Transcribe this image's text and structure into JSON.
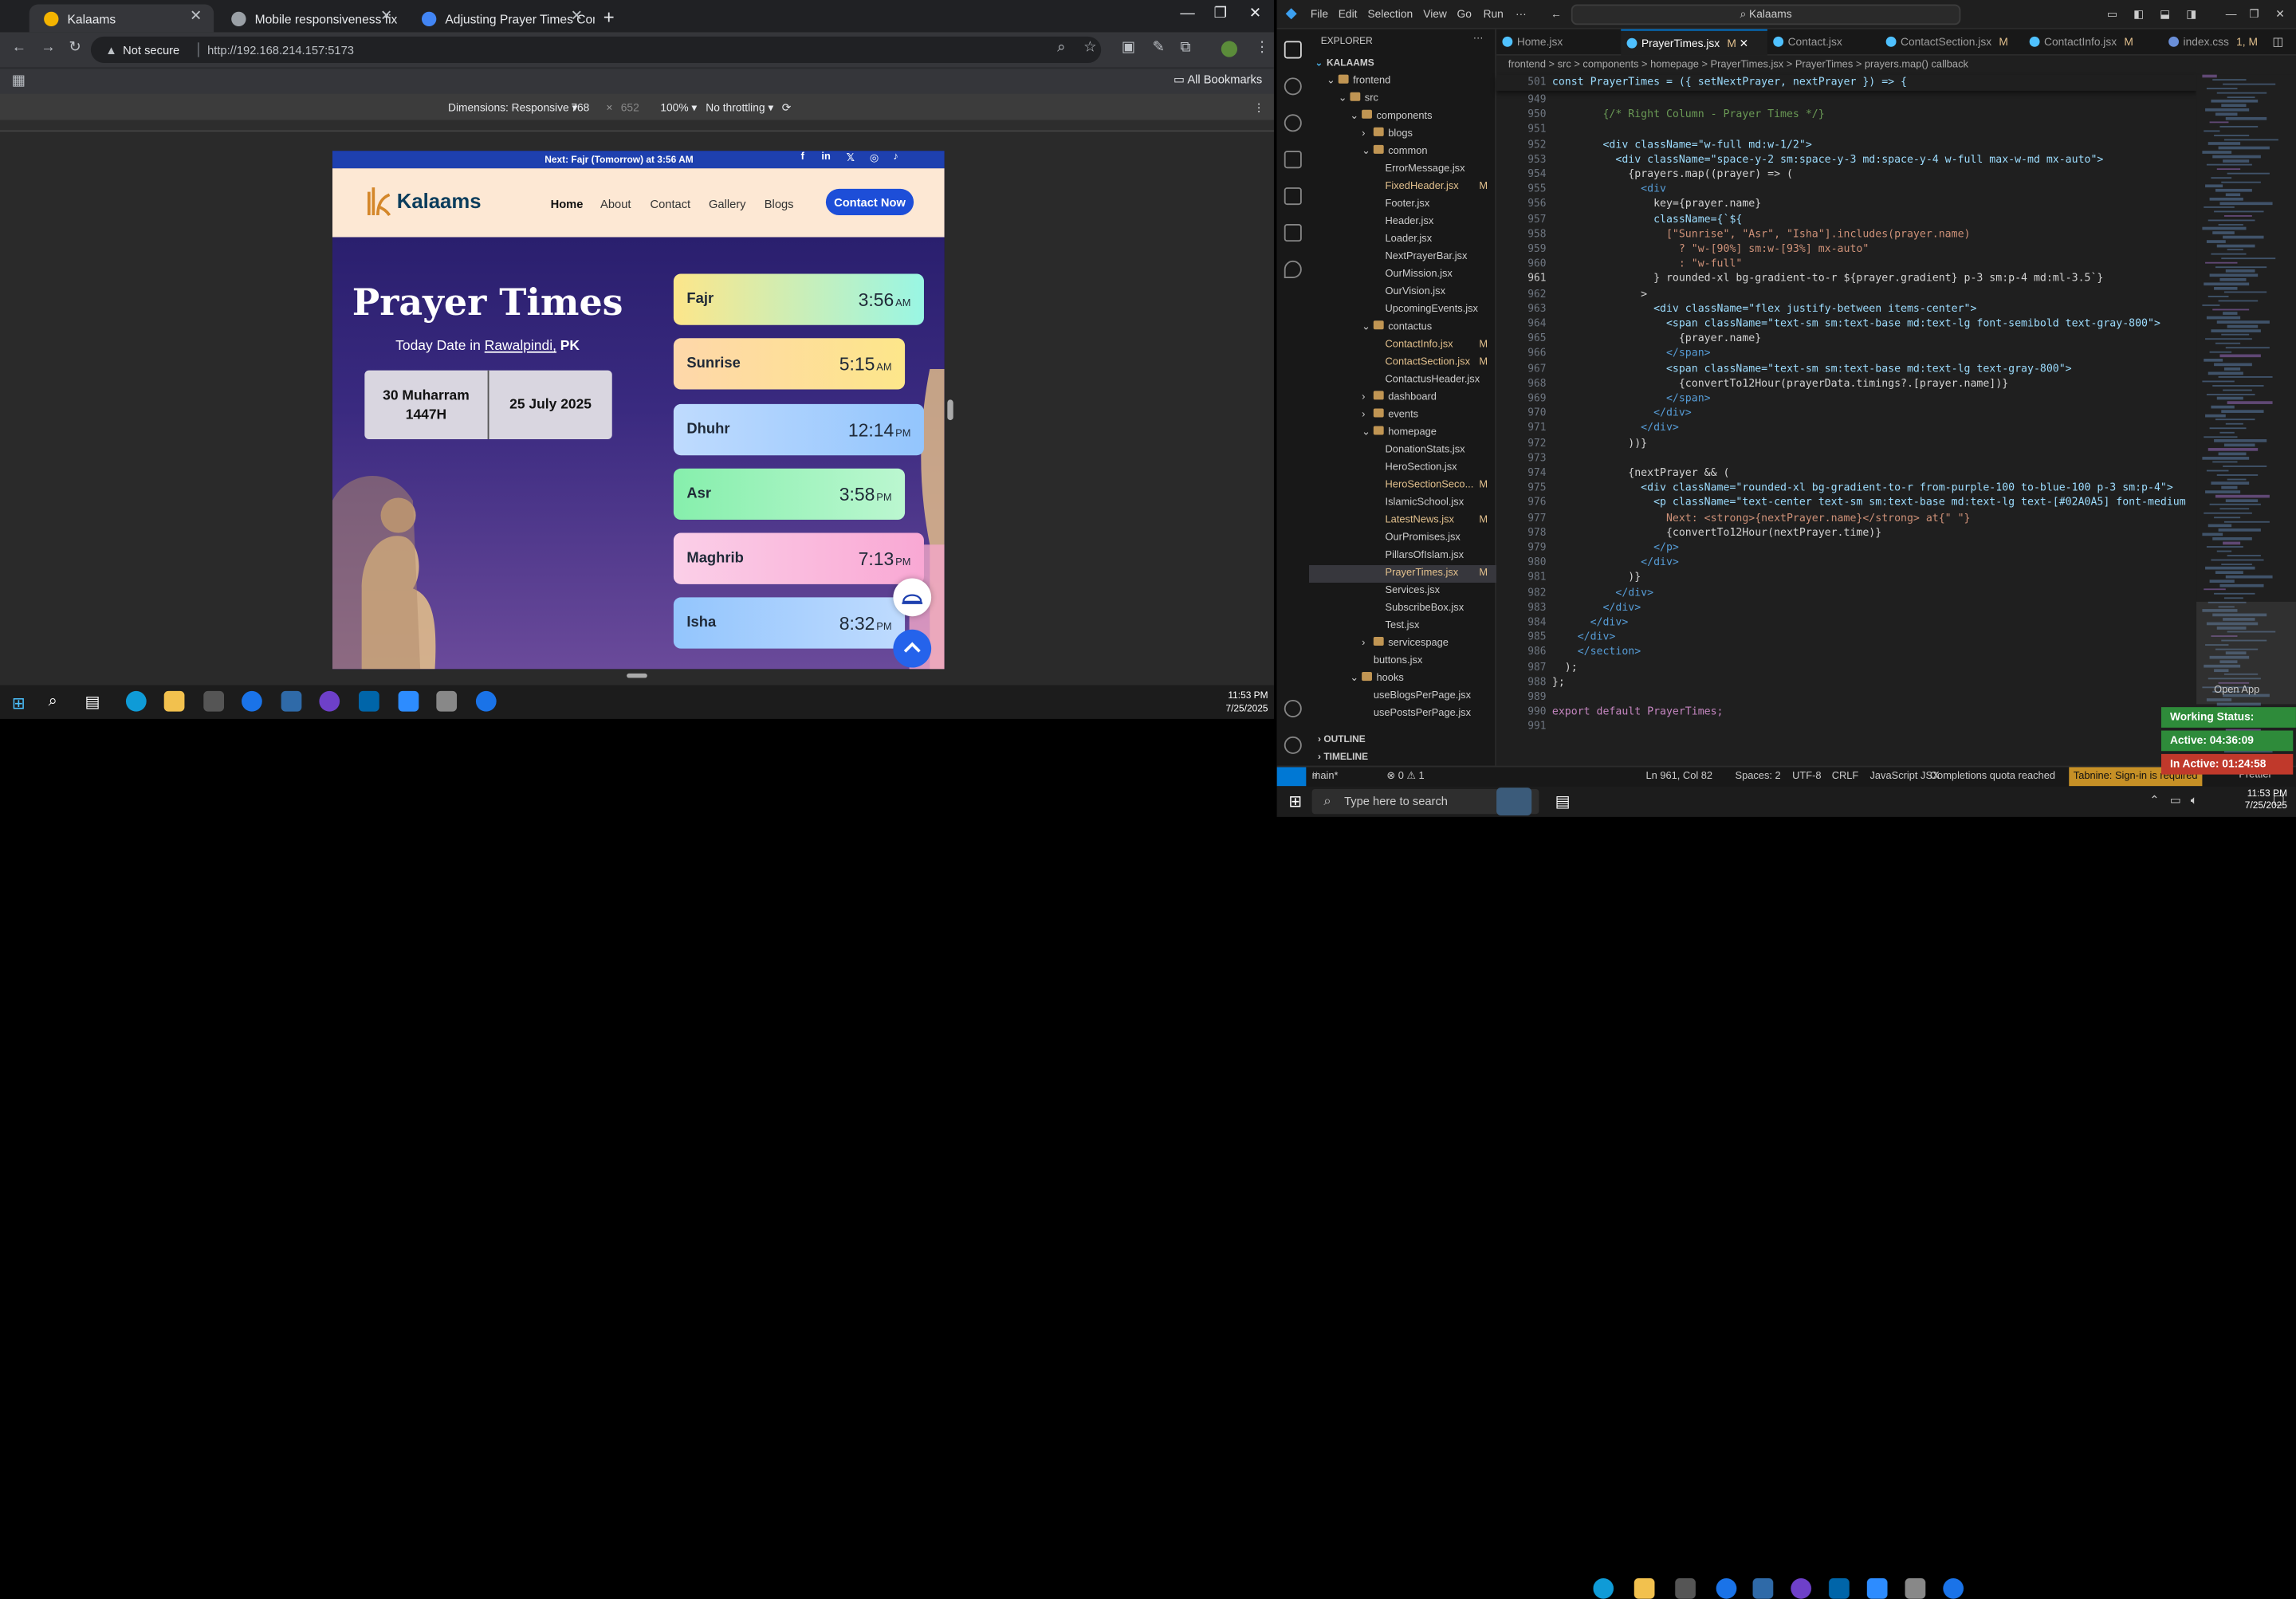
{
  "browser": {
    "tabs": [
      {
        "title": "Kalaams",
        "color": "#f4b400"
      },
      {
        "title": "Mobile responsiveness fix",
        "color": "#9aa0a6"
      },
      {
        "title": "Adjusting Prayer Times Contain",
        "color": "#4285f4"
      }
    ],
    "not_secure": "Not secure",
    "url": "http://192.168.214.157:5173",
    "all_bookmarks": "All Bookmarks",
    "devtools": {
      "dimensions": "Dimensions: Responsive",
      "width": "768",
      "height": "652",
      "zoom": "100%",
      "throttle": "No throttling"
    }
  },
  "site": {
    "announcement": "Next: Fajr (Tomorrow) at 3:56 AM",
    "brand": "Kalaams",
    "nav": [
      "Home",
      "About",
      "Contact",
      "Gallery",
      "Blogs"
    ],
    "cta": "Contact Now",
    "title": "Prayer Times",
    "date_prefix": "Today Date in",
    "city": "Rawalpindi,",
    "country": "PK",
    "hijri_line1": "30 Muharram",
    "hijri_line2": "1447H",
    "gregorian": "25 July 2025",
    "prayers": [
      {
        "name": "Fajr",
        "time": "3:56",
        "ampm": "AM",
        "color": "linear-gradient(90deg,#fde68a,#99f6e4)"
      },
      {
        "name": "Sunrise",
        "time": "5:15",
        "ampm": "AM",
        "color": "linear-gradient(90deg,#fed7aa,#fde68a)"
      },
      {
        "name": "Dhuhr",
        "time": "12:14",
        "ampm": "PM",
        "color": "linear-gradient(90deg,#bfdbfe,#93c5fd)"
      },
      {
        "name": "Asr",
        "time": "3:58",
        "ampm": "PM",
        "color": "linear-gradient(90deg,#86efac,#bbf7d0)"
      },
      {
        "name": "Maghrib",
        "time": "7:13",
        "ampm": "PM",
        "color": "linear-gradient(90deg,#fbcfe8,#f9a8d4)"
      },
      {
        "name": "Isha",
        "time": "8:32",
        "ampm": "PM",
        "color": "linear-gradient(90deg,#93c5fd,#bfdbfe)"
      }
    ]
  },
  "taskbar_left": {
    "time": "11:53 PM",
    "date": "7/25/2025"
  },
  "vscode": {
    "menu": [
      "File",
      "Edit",
      "Selection",
      "View",
      "Go",
      "Run"
    ],
    "search": "Kalaams",
    "explorer_title": "EXPLORER",
    "tree": [
      {
        "label": "KALAAMS",
        "depth": 0,
        "folder": false,
        "mark": ""
      },
      {
        "label": "frontend",
        "depth": 1,
        "folder": true,
        "mark": ""
      },
      {
        "label": "src",
        "depth": 2,
        "folder": true,
        "mark": ""
      },
      {
        "label": "components",
        "depth": 3,
        "folder": true,
        "mark": ""
      },
      {
        "label": "blogs",
        "depth": 4,
        "folder": true,
        "mark": ""
      },
      {
        "label": "common",
        "depth": 4,
        "folder": true,
        "mark": ""
      },
      {
        "label": "ErrorMessage.jsx",
        "depth": 5,
        "folder": false,
        "mark": ""
      },
      {
        "label": "FixedHeader.jsx",
        "depth": 5,
        "folder": false,
        "mark": "M"
      },
      {
        "label": "Footer.jsx",
        "depth": 5,
        "folder": false,
        "mark": ""
      },
      {
        "label": "Header.jsx",
        "depth": 5,
        "folder": false,
        "mark": ""
      },
      {
        "label": "Loader.jsx",
        "depth": 5,
        "folder": false,
        "mark": ""
      },
      {
        "label": "NextPrayerBar.jsx",
        "depth": 5,
        "folder": false,
        "mark": ""
      },
      {
        "label": "OurMission.jsx",
        "depth": 5,
        "folder": false,
        "mark": ""
      },
      {
        "label": "OurVision.jsx",
        "depth": 5,
        "folder": false,
        "mark": ""
      },
      {
        "label": "UpcomingEvents.jsx",
        "depth": 5,
        "folder": false,
        "mark": ""
      },
      {
        "label": "contactus",
        "depth": 4,
        "folder": true,
        "mark": ""
      },
      {
        "label": "ContactInfo.jsx",
        "depth": 5,
        "folder": false,
        "mark": "M"
      },
      {
        "label": "ContactSection.jsx",
        "depth": 5,
        "folder": false,
        "mark": "M"
      },
      {
        "label": "ContactusHeader.jsx",
        "depth": 5,
        "folder": false,
        "mark": ""
      },
      {
        "label": "dashboard",
        "depth": 4,
        "folder": true,
        "mark": ""
      },
      {
        "label": "events",
        "depth": 4,
        "folder": true,
        "mark": ""
      },
      {
        "label": "homepage",
        "depth": 4,
        "folder": true,
        "mark": ""
      },
      {
        "label": "DonationStats.jsx",
        "depth": 5,
        "folder": false,
        "mark": ""
      },
      {
        "label": "HeroSection.jsx",
        "depth": 5,
        "folder": false,
        "mark": ""
      },
      {
        "label": "HeroSectionSeco...",
        "depth": 5,
        "folder": false,
        "mark": "M"
      },
      {
        "label": "IslamicSchool.jsx",
        "depth": 5,
        "folder": false,
        "mark": ""
      },
      {
        "label": "LatestNews.jsx",
        "depth": 5,
        "folder": false,
        "mark": "M"
      },
      {
        "label": "OurPromises.jsx",
        "depth": 5,
        "folder": false,
        "mark": ""
      },
      {
        "label": "PillarsOfIslam.jsx",
        "depth": 5,
        "folder": false,
        "mark": ""
      },
      {
        "label": "PrayerTimes.jsx",
        "depth": 5,
        "folder": false,
        "mark": "M"
      },
      {
        "label": "Services.jsx",
        "depth": 5,
        "folder": false,
        "mark": ""
      },
      {
        "label": "SubscribeBox.jsx",
        "depth": 5,
        "folder": false,
        "mark": ""
      },
      {
        "label": "Test.jsx",
        "depth": 5,
        "folder": false,
        "mark": ""
      },
      {
        "label": "servicespage",
        "depth": 4,
        "folder": true,
        "mark": ""
      },
      {
        "label": "buttons.jsx",
        "depth": 4,
        "folder": false,
        "mark": ""
      },
      {
        "label": "hooks",
        "depth": 3,
        "folder": true,
        "mark": ""
      },
      {
        "label": "useBlogsPerPage.jsx",
        "depth": 4,
        "folder": false,
        "mark": ""
      },
      {
        "label": "usePostsPerPage.jsx",
        "depth": 4,
        "folder": false,
        "mark": ""
      }
    ],
    "outline": "OUTLINE",
    "timeline": "TIMELINE",
    "tabs": [
      {
        "label": "Home.jsx",
        "mark": ""
      },
      {
        "label": "PrayerTimes.jsx",
        "mark": "M"
      },
      {
        "label": "Contact.jsx",
        "mark": ""
      },
      {
        "label": "ContactSection.jsx",
        "mark": "M"
      },
      {
        "label": "ContactInfo.jsx",
        "mark": "M"
      },
      {
        "label": "index.css",
        "mark": "1, M"
      }
    ],
    "breadcrumb": "frontend > src > components > homepage > PrayerTimes.jsx > PrayerTimes > prayers.map() callback",
    "header_line": {
      "num": "501",
      "text": "const PrayerTimes = ({ setNextPrayer, nextPrayer }) => {"
    },
    "code": [
      {
        "n": "949",
        "t": ""
      },
      {
        "n": "950",
        "t": "        {/* Right Column - Prayer Times */}"
      },
      {
        "n": "951",
        "t": ""
      },
      {
        "n": "952",
        "t": "        <div className=\"w-full md:w-1/2\">"
      },
      {
        "n": "953",
        "t": "          <div className=\"space-y-2 sm:space-y-3 md:space-y-4 w-full max-w-md mx-auto\">"
      },
      {
        "n": "954",
        "t": "            {prayers.map((prayer) => ("
      },
      {
        "n": "955",
        "t": "              <div"
      },
      {
        "n": "956",
        "t": "                key={prayer.name}"
      },
      {
        "n": "957",
        "t": "                className={`${"
      },
      {
        "n": "958",
        "t": "                  [\"Sunrise\", \"Asr\", \"Isha\"].includes(prayer.name)"
      },
      {
        "n": "959",
        "t": "                    ? \"w-[90%] sm:w-[93%] mx-auto\""
      },
      {
        "n": "960",
        "t": "                    : \"w-full\""
      },
      {
        "n": "961",
        "t": "                } rounded-xl bg-gradient-to-r ${prayer.gradient} p-3 sm:p-4 md:ml-3.5`}"
      },
      {
        "n": "962",
        "t": "              >"
      },
      {
        "n": "963",
        "t": "                <div className=\"flex justify-between items-center\">"
      },
      {
        "n": "964",
        "t": "                  <span className=\"text-sm sm:text-base md:text-lg font-semibold text-gray-800\">"
      },
      {
        "n": "965",
        "t": "                    {prayer.name}"
      },
      {
        "n": "966",
        "t": "                  </span>"
      },
      {
        "n": "967",
        "t": "                  <span className=\"text-sm sm:text-base md:text-lg text-gray-800\">"
      },
      {
        "n": "968",
        "t": "                    {convertTo12Hour(prayerData.timings?.[prayer.name])}"
      },
      {
        "n": "969",
        "t": "                  </span>"
      },
      {
        "n": "970",
        "t": "                </div>"
      },
      {
        "n": "971",
        "t": "              </div>"
      },
      {
        "n": "972",
        "t": "            ))}"
      },
      {
        "n": "973",
        "t": ""
      },
      {
        "n": "974",
        "t": "            {nextPrayer && ("
      },
      {
        "n": "975",
        "t": "              <div className=\"rounded-xl bg-gradient-to-r from-purple-100 to-blue-100 p-3 sm:p-4\">"
      },
      {
        "n": "976",
        "t": "                <p className=\"text-center text-sm sm:text-base md:text-lg text-[#02A0A5] font-medium"
      },
      {
        "n": "977",
        "t": "                  Next: <strong>{nextPrayer.name}</strong> at{\" \"}"
      },
      {
        "n": "978",
        "t": "                  {convertTo12Hour(nextPrayer.time)}"
      },
      {
        "n": "979",
        "t": "                </p>"
      },
      {
        "n": "980",
        "t": "              </div>"
      },
      {
        "n": "981",
        "t": "            )}"
      },
      {
        "n": "982",
        "t": "          </div>"
      },
      {
        "n": "983",
        "t": "        </div>"
      },
      {
        "n": "984",
        "t": "      </div>"
      },
      {
        "n": "985",
        "t": "    </div>"
      },
      {
        "n": "986",
        "t": "    </section>"
      },
      {
        "n": "987",
        "t": "  );"
      },
      {
        "n": "988",
        "t": "};"
      },
      {
        "n": "989",
        "t": ""
      },
      {
        "n": "990",
        "t": "export default PrayerTimes;"
      },
      {
        "n": "991",
        "t": ""
      }
    ],
    "status": {
      "branch": "main*",
      "problems": "⊗ 0 ⚠ 1",
      "position": "Ln 961, Col 82",
      "spaces": "Spaces: 2",
      "encoding": "UTF-8",
      "eol": "CRLF",
      "lang": "JavaScript JSX",
      "quota": "Completions quota reached",
      "tabnine": "Tabnine: Sign-in is required",
      "prettier": "Prettier"
    },
    "open_app": "Open App",
    "badges": {
      "working": "Working Status: Active",
      "active": "Active: 04:36:09",
      "inactive": "In Active: 01:24:58"
    }
  },
  "taskbar": {
    "search": "Type here to search",
    "time": "11:53 PM",
    "date": "7/25/2025"
  }
}
